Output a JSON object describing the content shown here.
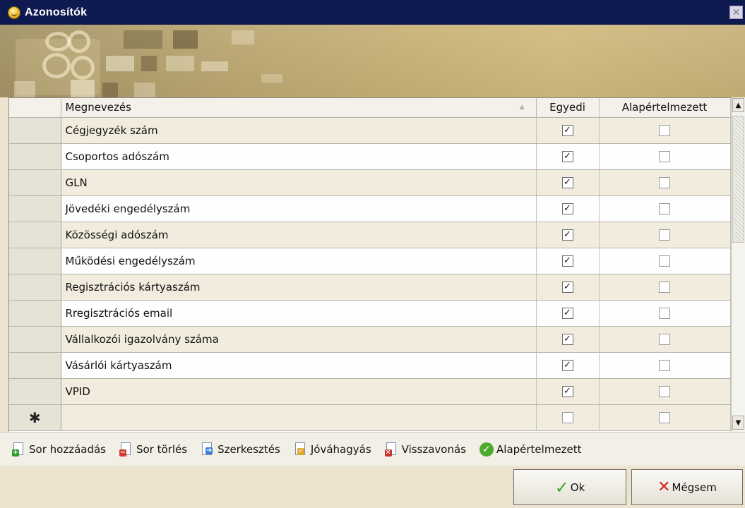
{
  "window": {
    "title": "Azonosítók",
    "close_glyph": "✕"
  },
  "grid": {
    "columns": {
      "name": "Megnevezés",
      "unique": "Egyedi",
      "default": "Alapértelmezett"
    },
    "rows": [
      {
        "name": "Cégjegyzék szám",
        "unique": true,
        "default": false
      },
      {
        "name": "Csoportos adószám",
        "unique": true,
        "default": false
      },
      {
        "name": "GLN",
        "unique": true,
        "default": false
      },
      {
        "name": "Jövedéki engedélyszám",
        "unique": true,
        "default": false
      },
      {
        "name": "Közösségi adószám",
        "unique": true,
        "default": false
      },
      {
        "name": "Működési engedélyszám",
        "unique": true,
        "default": false
      },
      {
        "name": "Regisztrációs kártyaszám",
        "unique": true,
        "default": false
      },
      {
        "name": "Rregisztrációs email",
        "unique": true,
        "default": false
      },
      {
        "name": "Vállalkozói igazolvány száma",
        "unique": true,
        "default": false
      },
      {
        "name": "Vásárlói kártyaszám",
        "unique": true,
        "default": false
      },
      {
        "name": "VPID",
        "unique": true,
        "default": false
      }
    ],
    "new_row_marker": "✱"
  },
  "toolbar": {
    "add_row": "Sor hozzáadás",
    "delete_row": "Sor törlés",
    "edit": "Szerkesztés",
    "approve": "Jóváhagyás",
    "revert": "Visszavonás",
    "set_default": "Alapértelmezett"
  },
  "buttons": {
    "ok": "Ok",
    "cancel": "Mégsem"
  },
  "colors": {
    "titlebar": "#0e1a4f",
    "banner": "#c9b37a",
    "row_alt": "#f1ecdd",
    "background": "#ece4cf"
  }
}
